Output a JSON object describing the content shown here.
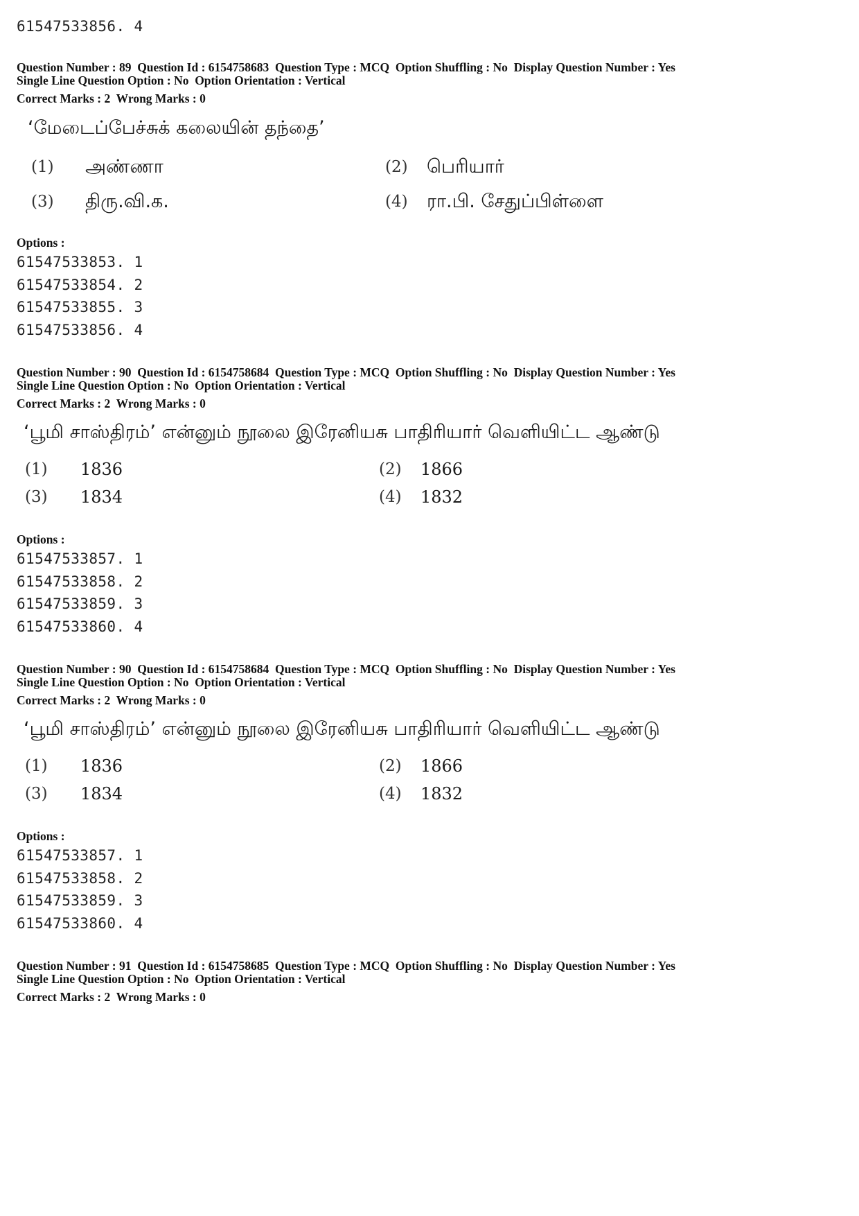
{
  "top_fragment": {
    "option_line": "61547533856. 4"
  },
  "questions": [
    {
      "meta_line1": "Question Number : 89  Question Id : 6154758683  Question Type : MCQ  Option Shuffling : No  Display Question Number : Yes",
      "meta_line2": "Single Line Question Option : No  Option Orientation : Vertical",
      "marks_line": "Correct Marks : 2  Wrong Marks : 0",
      "question_text": "‘மேடைப்பேச்சுக் கலையின் தந்தை’",
      "choices": [
        {
          "num": "(1)",
          "text": "அண்ணா"
        },
        {
          "num": "(2)",
          "text": "பெரியார்"
        },
        {
          "num": "(3)",
          "text": "திரு.வி.க."
        },
        {
          "num": "(4)",
          "text": "ரா.பி. சேதுப்பிள்ளை"
        }
      ],
      "options_label": "Options :",
      "option_ids": [
        "61547533853. 1",
        "61547533854. 2",
        "61547533855. 3",
        "61547533856. 4"
      ]
    },
    {
      "meta_line1": "Question Number : 90  Question Id : 6154758684  Question Type : MCQ  Option Shuffling : No  Display Question Number : Yes",
      "meta_line2": "Single Line Question Option : No  Option Orientation : Vertical",
      "marks_line": "Correct Marks : 2  Wrong Marks : 0",
      "question_text": "‘பூமி சாஸ்திரம்’ என்னும் நூலை இரேனியசு பாதிரியார் வெளியிட்ட ஆண்டு",
      "choices": [
        {
          "num": "(1)",
          "text": "1836"
        },
        {
          "num": "(2)",
          "text": "1866"
        },
        {
          "num": "(3)",
          "text": "1834"
        },
        {
          "num": "(4)",
          "text": "1832"
        }
      ],
      "options_label": "Options :",
      "option_ids": [
        "61547533857. 1",
        "61547533858. 2",
        "61547533859. 3",
        "61547533860. 4"
      ]
    },
    {
      "meta_line1": "Question Number : 90  Question Id : 6154758684  Question Type : MCQ  Option Shuffling : No  Display Question Number : Yes",
      "meta_line2": "Single Line Question Option : No  Option Orientation : Vertical",
      "marks_line": "Correct Marks : 2  Wrong Marks : 0",
      "question_text": "‘பூமி சாஸ்திரம்’ என்னும் நூலை இரேனியசு பாதிரியார் வெளியிட்ட ஆண்டு",
      "choices": [
        {
          "num": "(1)",
          "text": "1836"
        },
        {
          "num": "(2)",
          "text": "1866"
        },
        {
          "num": "(3)",
          "text": "1834"
        },
        {
          "num": "(4)",
          "text": "1832"
        }
      ],
      "options_label": "Options :",
      "option_ids": [
        "61547533857. 1",
        "61547533858. 2",
        "61547533859. 3",
        "61547533860. 4"
      ]
    },
    {
      "meta_line1": "Question Number : 91  Question Id : 6154758685  Question Type : MCQ  Option Shuffling : No  Display Question Number : Yes",
      "meta_line2": "Single Line Question Option : No  Option Orientation : Vertical",
      "marks_line": "Correct Marks : 2  Wrong Marks : 0"
    }
  ]
}
